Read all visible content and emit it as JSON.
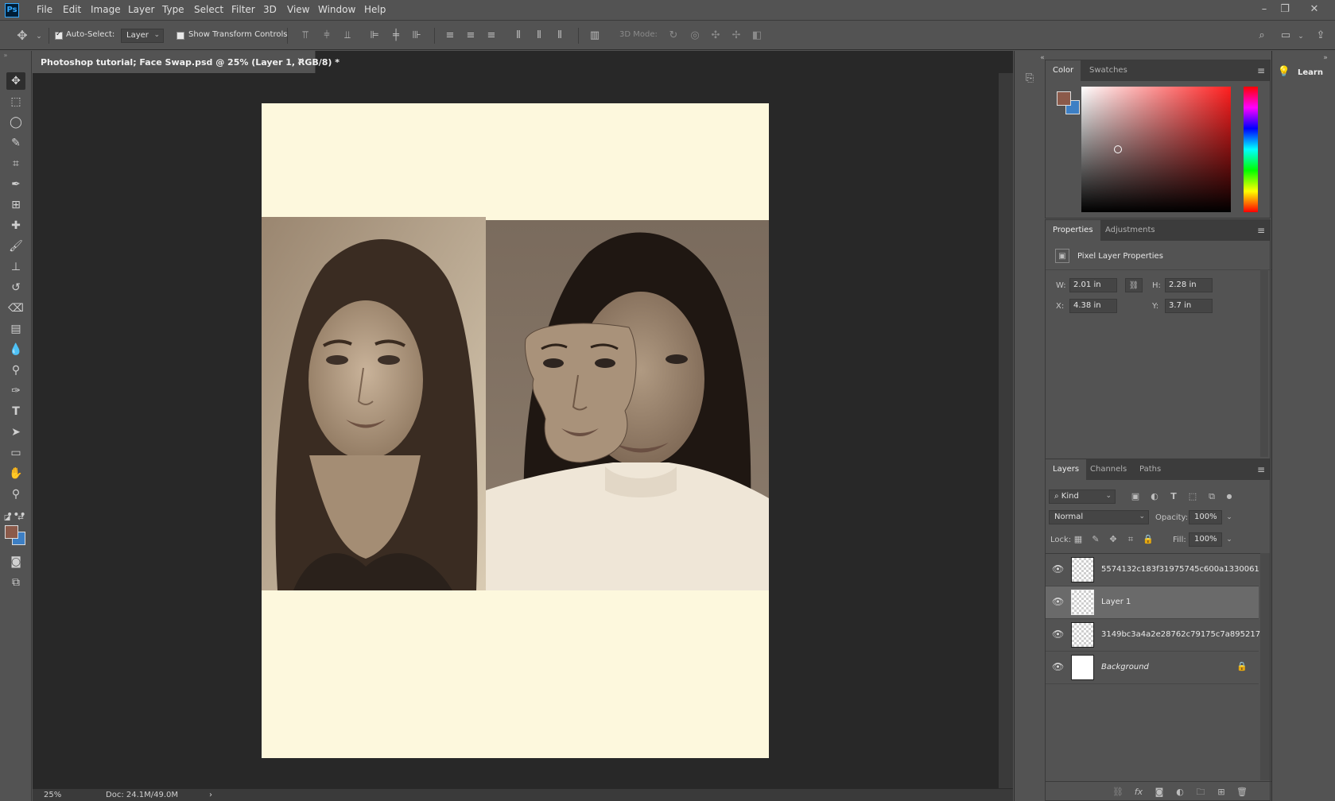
{
  "app": {
    "logo": "Ps",
    "menu": [
      "File",
      "Edit",
      "Image",
      "Layer",
      "Type",
      "Select",
      "Filter",
      "3D",
      "View",
      "Window",
      "Help"
    ]
  },
  "options_bar": {
    "auto_select_label": "Auto-Select:",
    "auto_select_checked": true,
    "auto_select_target": "Layer",
    "show_transform_label": "Show Transform Controls",
    "show_transform_checked": false,
    "mode_3d_label": "3D Mode:"
  },
  "document": {
    "tab_title": "Photoshop tutorial; Face Swap.psd @ 25% (Layer 1, RGB/8) *",
    "canvas_color": "#fdf8dd",
    "zoom": "25%",
    "doc_size": "Doc: 24.1M/49.0M"
  },
  "colors": {
    "foreground": "#8b5a4a",
    "background": "#3d7fc4",
    "picker_hue": "#ff1f1f"
  },
  "color_panel": {
    "tabs": [
      "Color",
      "Swatches"
    ],
    "active_tab": "Color"
  },
  "properties_panel": {
    "tabs": [
      "Properties",
      "Adjustments"
    ],
    "active_tab": "Properties",
    "section_title": "Pixel Layer Properties",
    "w_label": "W:",
    "w_value": "2.01 in",
    "h_label": "H:",
    "h_value": "2.28 in",
    "x_label": "X:",
    "x_value": "4.38 in",
    "y_label": "Y:",
    "y_value": "3.7 in"
  },
  "layers_panel": {
    "tabs": [
      "Layers",
      "Channels",
      "Paths"
    ],
    "active_tab": "Layers",
    "filter_kind": "Kind",
    "blend_mode": "Normal",
    "opacity_label": "Opacity:",
    "opacity_value": "100%",
    "lock_label": "Lock:",
    "fill_label": "Fill:",
    "fill_value": "100%",
    "layers": [
      {
        "name": "5574132c183f31975745c600a1330061",
        "visible": true,
        "selected": false
      },
      {
        "name": "Layer 1",
        "visible": true,
        "selected": true
      },
      {
        "name": "3149bc3a4a2e28762c79175c7a895217",
        "visible": true,
        "selected": false
      },
      {
        "name": "Background",
        "visible": true,
        "selected": false,
        "locked": true
      }
    ]
  },
  "learn_panel": {
    "label": "Learn"
  }
}
